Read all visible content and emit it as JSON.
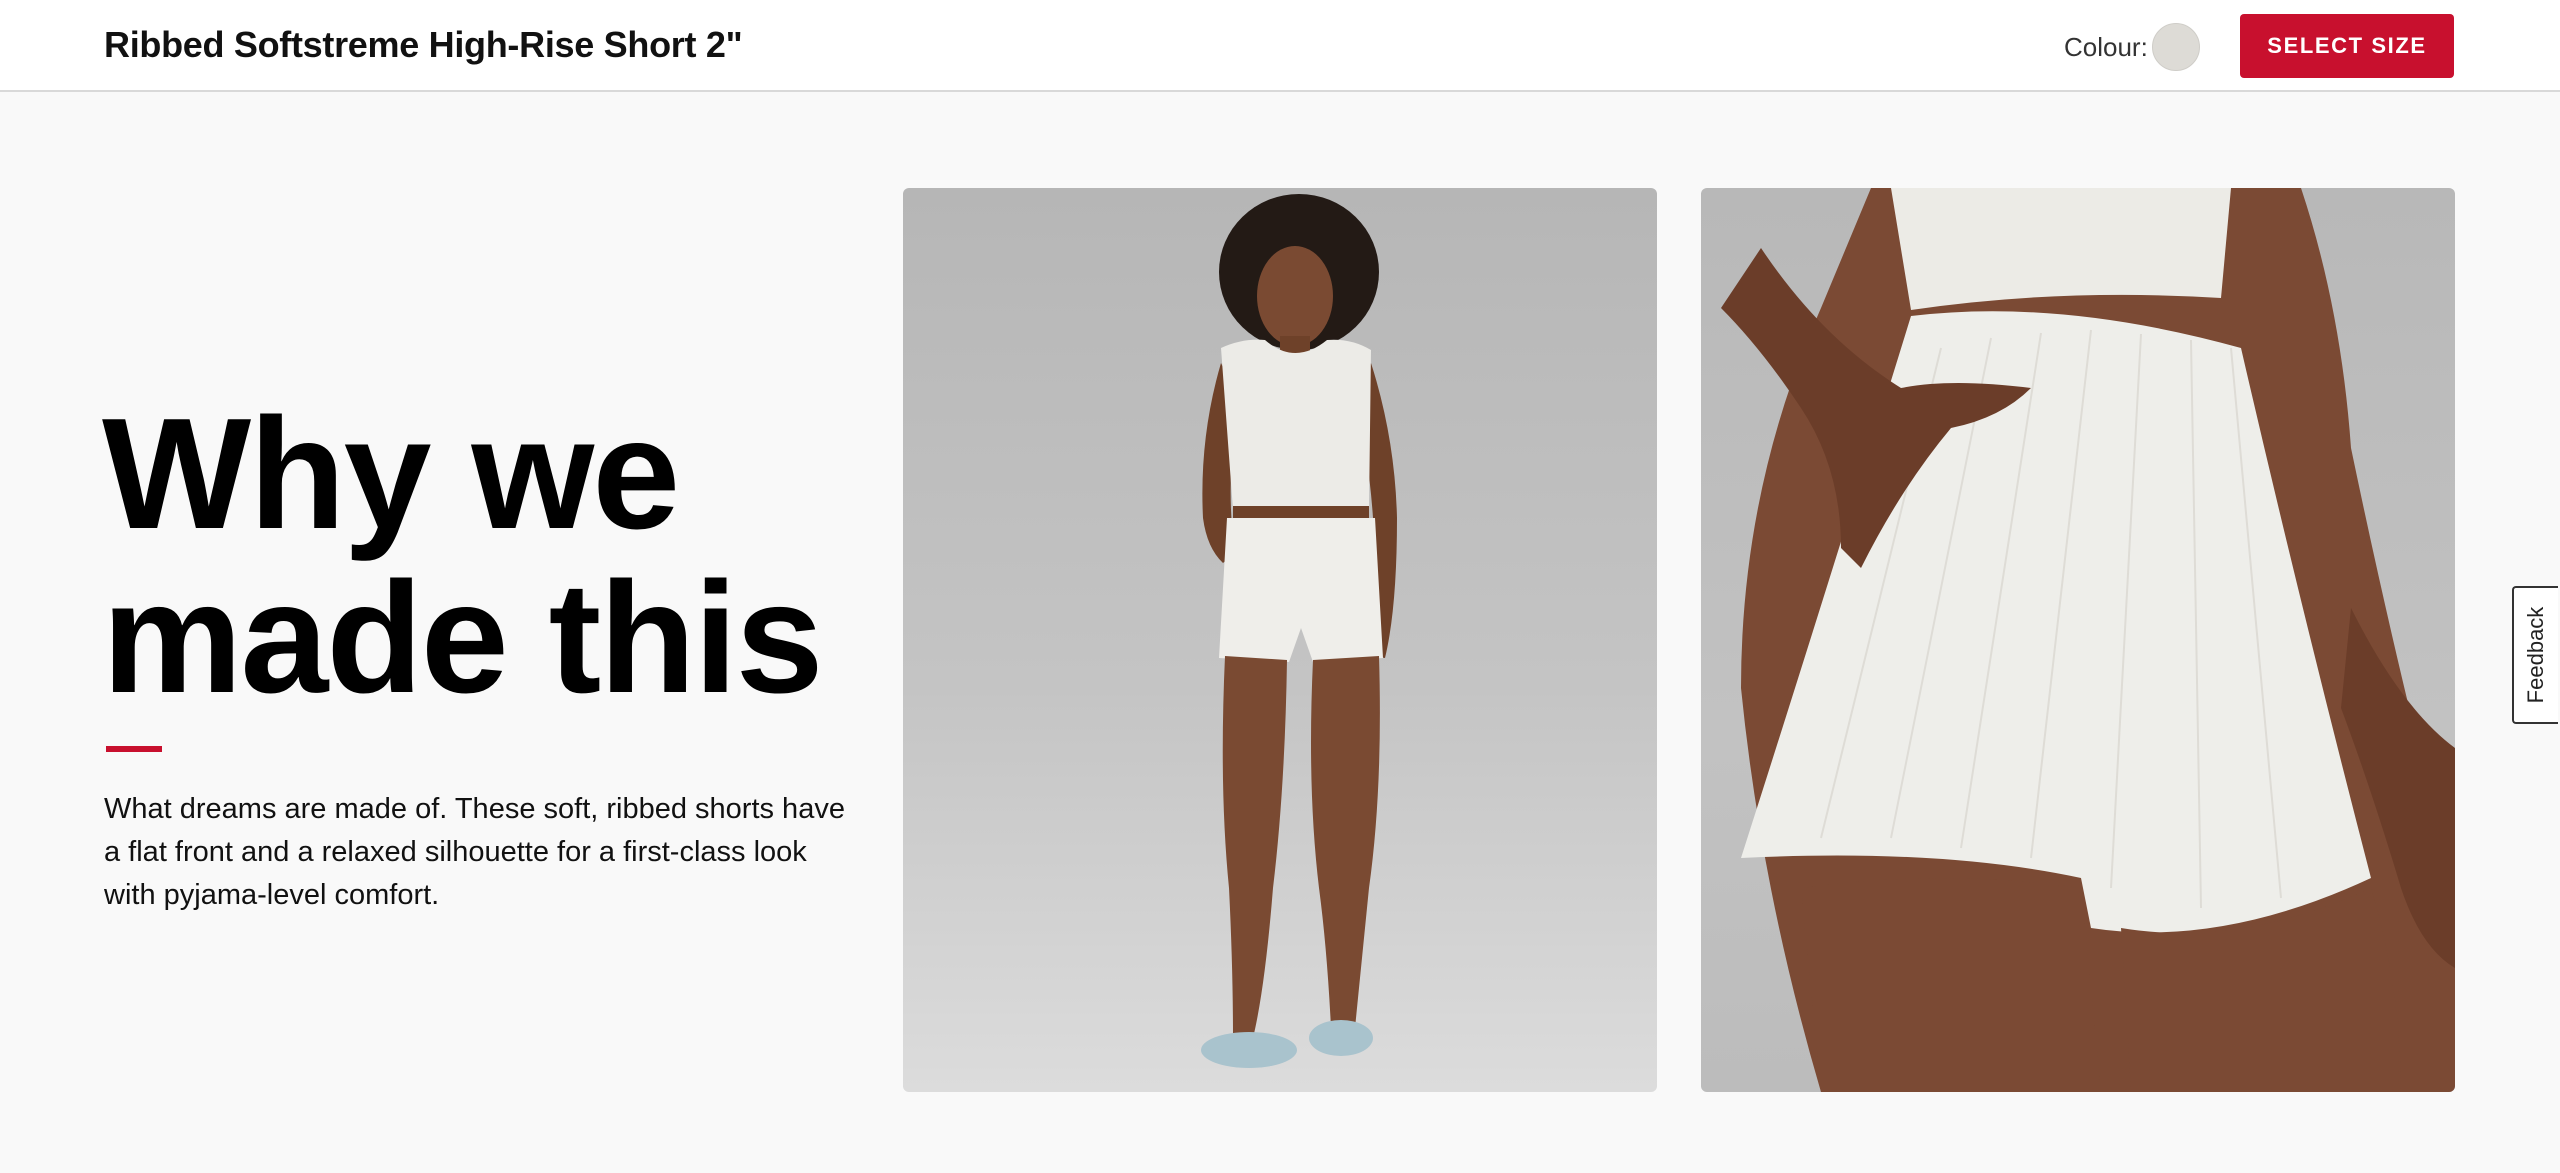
{
  "header": {
    "product_title": "Ribbed Softstreme High-Rise Short 2\"",
    "colour_label": "Colour:",
    "colour_swatch_color": "#dddbd6",
    "select_size_label": "SELECT SIZE"
  },
  "story": {
    "headline": "Why we\nmade this",
    "description": "What dreams are made of. These soft, ribbed shorts have a flat front and a relaxed silhouette for a first-class look with pyjama-level comfort."
  },
  "images": [
    {
      "alt": "Model wearing white ribbed crop tank and high-rise shorts with light blue slides"
    },
    {
      "alt": "Close-up of hand in pocket of white ribbed high-rise shorts"
    }
  ],
  "feedback": {
    "label": "Feedback"
  },
  "colors": {
    "accent": "#c8102e",
    "background": "#f9f9f9"
  }
}
